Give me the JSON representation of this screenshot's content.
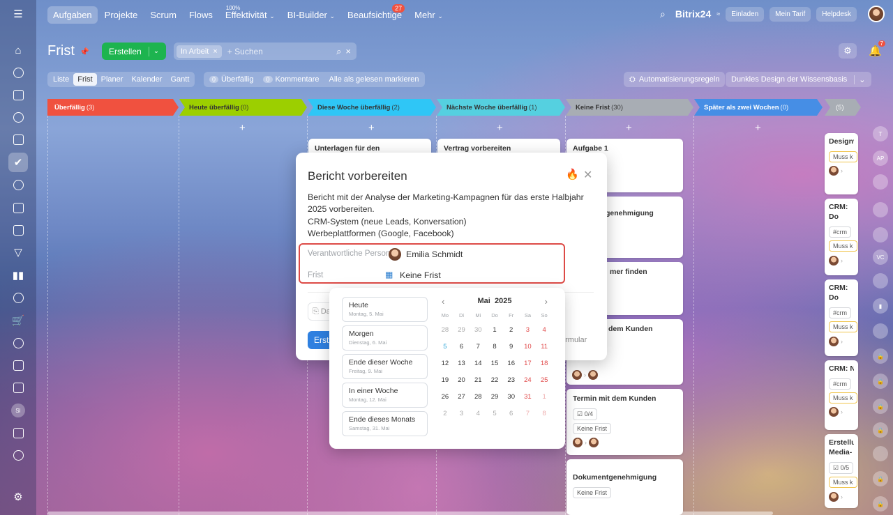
{
  "topnav": {
    "items": [
      {
        "label": "Aufgaben",
        "active": true
      },
      {
        "label": "Projekte"
      },
      {
        "label": "Scrum"
      },
      {
        "label": "Flows"
      },
      {
        "label": "Effektivität",
        "sup": "100%",
        "dropdown": true
      },
      {
        "label": "BI-Builder",
        "dropdown": true
      },
      {
        "label": "Beaufsichtige",
        "badge": "27"
      },
      {
        "label": "Mehr",
        "dropdown": true
      }
    ],
    "brand": "Bitrix24",
    "invite": "Einladen",
    "tariff": "Mein Tarif",
    "helpdesk": "Helpdesk"
  },
  "page": {
    "title": "Frist",
    "create_label": "Erstellen",
    "filter_chip": "In Arbeit",
    "search_placeholder": "+ Suchen",
    "notifications_badge": "7"
  },
  "views": [
    "Liste",
    "Frist",
    "Planer",
    "Kalender",
    "Gantt"
  ],
  "counters": {
    "overdue_count": "0",
    "overdue_label": "Überfällig",
    "comments_count": "0",
    "comments_label": "Kommentare",
    "mark_read": "Alle als gelesen markieren"
  },
  "automation_label": "Automatisierungsregeln",
  "theme_label": "Dunkles Design der Wissensbasis",
  "columns": [
    {
      "title": "Überfällig",
      "count": "(3)",
      "color": "#f0513f"
    },
    {
      "title": "Heute überfällig",
      "count": "(0)",
      "color": "#9ccf00"
    },
    {
      "title": "Diese Woche überfällig",
      "count": "(2)",
      "color": "#2fc6f6"
    },
    {
      "title": "Nächste Woche überfällig",
      "count": "(1)",
      "color": "#55d0e0"
    },
    {
      "title": "Keine Frist",
      "count": "(30)",
      "color": "#a8adb4"
    },
    {
      "title": "Später als zwei Wochen",
      "count": "(0)",
      "color": "#468ee5"
    },
    {
      "title": "",
      "count": "(5)",
      "color": "#a8adb4"
    }
  ],
  "cards": {
    "col3": "Unterlagen für den",
    "col4": "Vertrag vorbereiten",
    "col5": [
      {
        "title": "Aufgabe 1"
      },
      {
        "title": "genehmigung"
      },
      {
        "title": "mer finden"
      },
      {
        "title": "dem Kunden"
      },
      {
        "title": "Termin mit dem Kunden",
        "checklist": "0/4",
        "tag": "Keine Frist"
      },
      {
        "title": "Dokumentgenehmigung",
        "tag": "Keine Frist"
      }
    ],
    "col7": [
      {
        "title": "Designv Lieferun",
        "tag": "Muss k"
      },
      {
        "title": "CRM: Do vorbereit",
        "hashtag": "#crm",
        "tag": "Muss k"
      },
      {
        "title": "CRM: Do vorbereit",
        "hashtag": "#crm",
        "tag": "Muss k"
      },
      {
        "title": "CRM: Ne",
        "hashtag": "#crm",
        "tag": "Muss k"
      },
      {
        "title": "Erstellun Media-B",
        "checklist": "0/5",
        "tag": "Muss k"
      }
    ]
  },
  "right_strip": [
    "T",
    "AP",
    "VC"
  ],
  "popup": {
    "title": "Bericht vorbereiten",
    "description": [
      "Bericht mit der Analyse der Marketing-Kampagnen für das erste Halbjahr",
      "2025 vorbereiten.",
      "CRM-System (neue Leads, Konversation)",
      "Werbeplattformen (Google, Facebook)"
    ],
    "responsible_label": "Verantwortliche Person",
    "responsible_value": "Emilia Schmidt",
    "deadline_label": "Frist",
    "deadline_value": "Keine Frist",
    "attach_label": "Da",
    "primary_label": "Erst",
    "form_link": "ormular"
  },
  "calendar": {
    "month": "Mai",
    "year": "2025",
    "quick": [
      {
        "title": "Heute",
        "sub": "Montag, 5. Mai"
      },
      {
        "title": "Morgen",
        "sub": "Dienstag, 6. Mai"
      },
      {
        "title": "Ende dieser Woche",
        "sub": "Freitag, 9. Mai"
      },
      {
        "title": "In einer Woche",
        "sub": "Montag, 12. Mai"
      },
      {
        "title": "Ende dieses Monats",
        "sub": "Samstag, 31. Mai"
      }
    ],
    "weekdays": [
      "Mo",
      "Di",
      "Mi",
      "Do",
      "Fr",
      "Sa",
      "So"
    ],
    "days": [
      [
        "28",
        "29",
        "30",
        "1",
        "2",
        "3",
        "4"
      ],
      [
        "5",
        "6",
        "7",
        "8",
        "9",
        "10",
        "11"
      ],
      [
        "12",
        "13",
        "14",
        "15",
        "16",
        "17",
        "18"
      ],
      [
        "19",
        "20",
        "21",
        "22",
        "23",
        "24",
        "25"
      ],
      [
        "26",
        "27",
        "28",
        "29",
        "30",
        "31",
        "1"
      ],
      [
        "2",
        "3",
        "4",
        "5",
        "6",
        "7",
        "8"
      ]
    ]
  }
}
